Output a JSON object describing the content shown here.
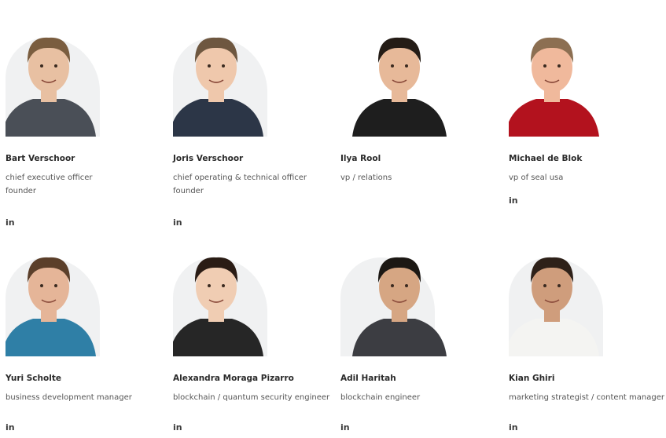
{
  "team": [
    {
      "name": "Bart Verschoor",
      "roles": [
        "chief executive officer",
        "founder"
      ],
      "link_label": "in",
      "bg": "#fbfbfb",
      "shirt": "#4a4f57",
      "skin": "#e8c0a2",
      "hair": "#7a5d3f"
    },
    {
      "name": "Joris Verschoor",
      "roles": [
        "chief operating & technical officer",
        "founder"
      ],
      "link_label": "in",
      "bg": "#fbfbfb",
      "shirt": "#2c3647",
      "skin": "#efc8ac",
      "hair": "#6e5740"
    },
    {
      "name": "Ilya Rool",
      "roles": [
        "vp / relations"
      ],
      "link_label": "in",
      "bg": "#ffffff",
      "shirt": "#1e1e1e",
      "skin": "#e7b999",
      "hair": "#241c16"
    },
    {
      "name": "Michael de Blok",
      "roles": [
        "vp of seal usa"
      ],
      "link_label": "in",
      "bg": "#ffffff",
      "shirt": "#b3121e",
      "skin": "#f0b99c",
      "hair": "#8c6f52"
    },
    {
      "name": "Yuri Scholte",
      "roles": [
        "business development manager"
      ],
      "link_label": "in",
      "bg": "#fbfbfb",
      "shirt": "#2f7fa6",
      "skin": "#e5b598",
      "hair": "#5b3f2a"
    },
    {
      "name": "Alexandra Moraga Pizarro",
      "roles": [
        "blockchain / quantum security engineer"
      ],
      "link_label": "in",
      "bg": "#fbfbfb",
      "shirt": "#262626",
      "skin": "#f0cdb3",
      "hair": "#2a1c15"
    },
    {
      "name": "Adil Haritah",
      "roles": [
        "blockchain engineer"
      ],
      "link_label": "in",
      "bg": "#ffffff",
      "shirt": "#3c3d42",
      "skin": "#d6a683",
      "hair": "#1c1814"
    },
    {
      "name": "Kian Ghiri",
      "roles": [
        "marketing strategist / content manager"
      ],
      "link_label": "in",
      "bg": "#ffffff",
      "shirt": "#f4f4f2",
      "skin": "#cf9d7c",
      "hair": "#2e2119"
    }
  ]
}
